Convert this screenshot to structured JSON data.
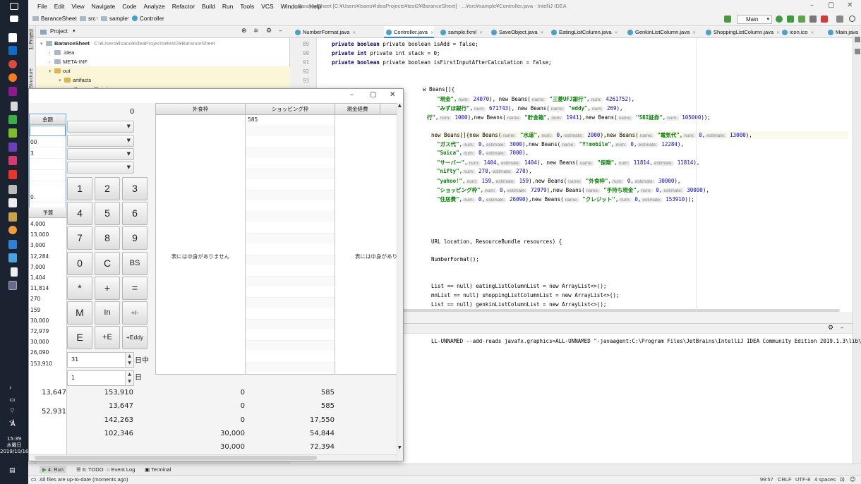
{
  "taskbar": {
    "time": "15:39",
    "weekday": "水曜日",
    "date": "2019/10/16",
    "ime": "A"
  },
  "ide": {
    "menu": [
      "File",
      "Edit",
      "View",
      "Navigate",
      "Code",
      "Analyze",
      "Refactor",
      "Build",
      "Run",
      "Tools",
      "VCS",
      "Window",
      "Help"
    ],
    "window_title": "BaranceSheet [C:¥Users¥Isano¥IdeaProjects¥test2¥BaranceSheet] - ...¥src¥sample¥Controller.java - IntelliJ IDEA",
    "breadcrumbs": [
      "BaranceSheet",
      "src",
      "sample",
      "Controller"
    ],
    "run_config": "Main",
    "left_stripe": [
      "1: Project",
      "Structure"
    ],
    "project": {
      "header": "Project",
      "root_label": "BaranceSheet",
      "root_path": "C:¥Users¥Isano¥IdeaProjects¥test2¥BaranceSheet",
      "tree": [
        ".idea",
        "META-INF",
        "out",
        "artifacts",
        "BaranceSheet"
      ]
    },
    "tabs": [
      "NumberFormat.java",
      "Controller.java",
      "sample.fxml",
      "SaveObject.java",
      "EatingListColumn.java",
      "GenkinListColumn.java",
      "ShoppingListColumn.java",
      "icon.ico",
      "Main.java"
    ],
    "line_numbers": [
      "89",
      "90",
      "91",
      "92",
      "93"
    ],
    "code": {
      "l89": "private boolean isAdd = false;",
      "l90": "private int stack = 0;",
      "l91": "private boolean isFirstInputAfterCalculation = false;",
      "l93": "w Beans[]{",
      "r1": [
        "\"現金\",",
        "num:",
        "24070",
        "), new Beans(",
        "name:",
        "\"三菱UFJ銀行\",",
        "num:",
        "4261752",
        "),"
      ],
      "r2": [
        "\"みずほ銀行\",",
        "num:",
        "671743",
        "), new Beans(",
        "name:",
        "\"eddy\",",
        "num:",
        "269",
        "),"
      ],
      "r3": [
        "行\",",
        "num:",
        "1000",
        "),new Beans(",
        "name:",
        "\"貯金箱\",",
        "num:",
        "1941",
        "),new Beans(",
        "name:",
        "\"SBI証券\",",
        "num:",
        "105000",
        "));"
      ],
      "r5": [
        "new Beans[]{new Beans(",
        "name:",
        "\"水道\",",
        "num:",
        "0",
        ",",
        "estimate:",
        "2000",
        "),new Beans(",
        "name:",
        "\"電気代\",",
        "num:",
        "0",
        ",",
        "estimate:",
        "13000",
        "),"
      ],
      "r6": [
        "\"ガス代\",",
        "num:",
        "0",
        ",",
        "estimate:",
        "3000",
        "),new Beans(",
        "name:",
        "\"Y!mobile\",",
        "num:",
        "0",
        ",",
        "estimate:",
        "12284",
        "),"
      ],
      "r7": [
        "\"Suica\",",
        "num:",
        "0",
        ",",
        "estimate:",
        "7000",
        "),"
      ],
      "r8": [
        "\"サーバー\",",
        "num:",
        "1404",
        ",",
        "estimate:",
        "1404",
        "), new Beans(",
        "name:",
        "\"保険\",",
        "num:",
        "11814",
        ",",
        "estimate:",
        "11814",
        "),"
      ],
      "r9": [
        "\"nifty\",",
        "num:",
        "270",
        ",",
        "estimate:",
        "270",
        "),"
      ],
      "r10": [
        "\"yahoo!\",",
        "num:",
        "159",
        ",",
        "estimate:",
        "159",
        "),new Beans(",
        "name:",
        "\"外食枠\",",
        "num:",
        "0",
        ",",
        "estimate:",
        "30000",
        "),"
      ],
      "r11": [
        "\"ショッピング枠\",",
        "num:",
        "0",
        ",",
        "estimate:",
        "72979",
        "),new Beans(",
        "name:",
        "\"手持ち現金\",",
        "num:",
        "0",
        ",",
        "estimate:",
        "30000",
        "),"
      ],
      "r12": [
        "\"住居費\",",
        "num:",
        "0",
        ",",
        "estimate:",
        "26090",
        "),new Beans(",
        "name:",
        "\"クレジット\",",
        "num:",
        "0",
        ",",
        "estimate:",
        "153910",
        "));"
      ],
      "init": "URL location, ResourceBundle resources) {",
      "nf": "NumberFormat();",
      "e1": "List == null) eatingListColumnList = new ArrayList<>();",
      "e2": "mnList == null) shoppingListColumnList = new ArrayList<>();",
      "e3": "List == null) genkinListColumnList = new ArrayList<>();"
    },
    "console": "LL-UNNAMED --add-reads javafx.graphics=ALL-UNNAMED \"-javaagent:C:\\Program Files\\JetBrains\\IntelliJ IDEA Community Edition 2019.1.3\\lib\\idea_rt.j",
    "bottom_tools": [
      "4: Run",
      "6: TODO",
      "Event Log",
      "Terminal"
    ],
    "status": {
      "message": "All files are up-to-date (moments ago)",
      "position": "99:57",
      "line_sep": "CRLF",
      "encoding": "UTF-8",
      "indent": "4 spaces"
    }
  },
  "app": {
    "total": "0",
    "kingaku_header": "金額",
    "kingaku_cells": [
      "",
      "00",
      "3",
      "",
      "",
      "0."
    ],
    "yosan_header": "予算",
    "yosan_values": [
      "4,000",
      "13,000",
      "3,000",
      "12,284",
      "7,000",
      "1,404",
      "11,814",
      "270",
      "159",
      "30,000",
      "72,979",
      "30,000",
      "26,090",
      "153,910"
    ],
    "keys": [
      "1",
      "2",
      "3",
      "4",
      "5",
      "6",
      "7",
      "8",
      "9",
      "0",
      "C",
      "BS",
      "*",
      "+",
      "=",
      "M",
      "In",
      "+/-",
      "E",
      "+E",
      "+Eddy"
    ],
    "day_spinner": "31",
    "day_label": "日中",
    "month_spinner": "1",
    "month_label": "日",
    "columns": [
      "外食枠",
      "ショッピング枠",
      "現金経費"
    ],
    "empty_message": "表には中身がありません",
    "empty_message_cut": "表には中身がありま",
    "shopping_first": "585",
    "left_sums": [
      "13,647",
      "52,931"
    ],
    "col1_sums": [
      "153,910",
      "13,647",
      "142,263",
      "102,346"
    ],
    "col2_sums": [
      "0",
      "0",
      "0",
      "30,000",
      "30,000"
    ],
    "col3_sums": [
      "585",
      "585",
      "17,550",
      "54,844",
      "72,394"
    ]
  }
}
